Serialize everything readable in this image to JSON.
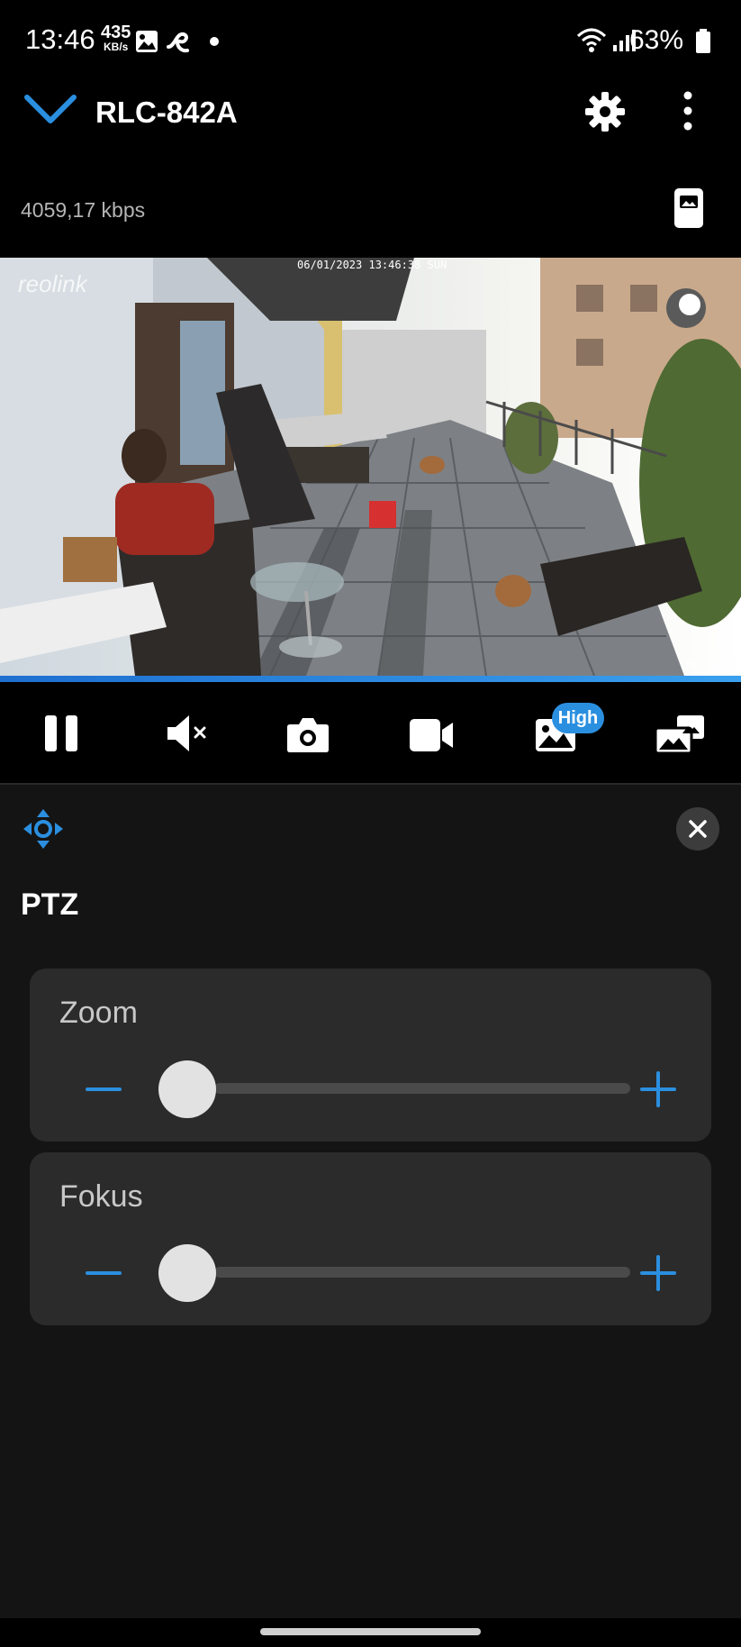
{
  "status_bar": {
    "time": "13:46",
    "net_speed_value": "435",
    "net_speed_unit": "KB/s",
    "battery": "63%"
  },
  "header": {
    "title": "RLC-842A"
  },
  "stream": {
    "bitrate": "4059,17 kbps"
  },
  "camera_overlay": {
    "brand": "reolink",
    "timestamp": "06/01/2023 13:46:38 SUN",
    "camera_name": "RLC-842A"
  },
  "toolbar": {
    "quality_badge": "High"
  },
  "ptz_panel": {
    "title": "PTZ",
    "zoom": {
      "label": "Zoom",
      "value": 0
    },
    "focus": {
      "label": "Fokus",
      "value": 0
    }
  },
  "colors": {
    "accent": "#2b8fe0",
    "background": "#141414",
    "card": "#2b2b2b"
  }
}
